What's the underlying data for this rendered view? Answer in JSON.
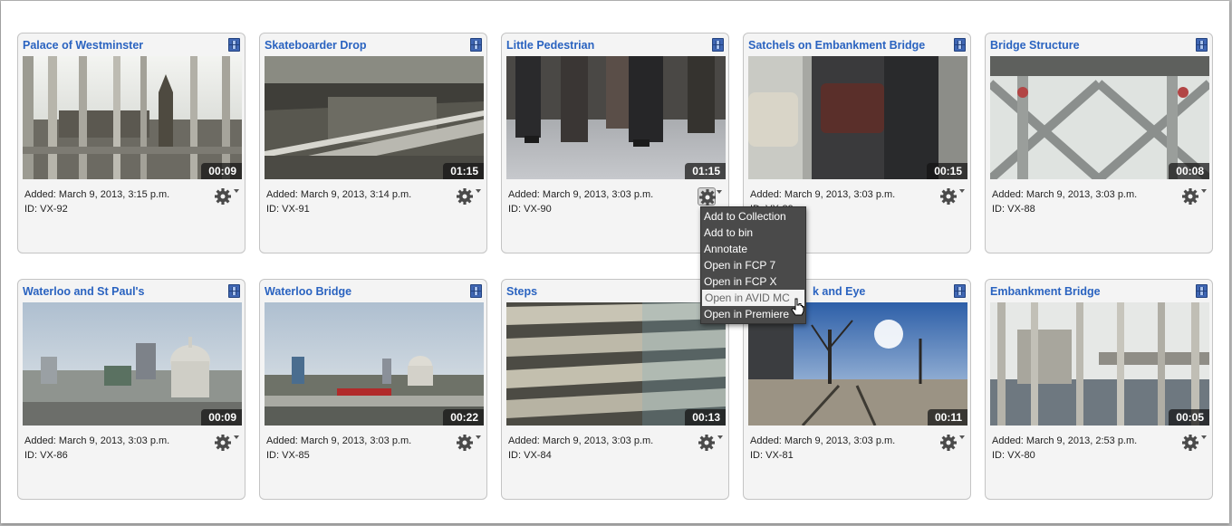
{
  "cards": [
    {
      "title": "Palace of Westminster",
      "duration": "00:09",
      "added": "Added: March 9, 2013, 3:15 p.m.",
      "id": "ID: VX-92"
    },
    {
      "title": "Skateboarder Drop",
      "duration": "01:15",
      "added": "Added: March 9, 2013, 3:14 p.m.",
      "id": "ID: VX-91"
    },
    {
      "title": "Little Pedestrian",
      "duration": "01:15",
      "added": "Added: March 9, 2013, 3:03 p.m.",
      "id": "ID: VX-90"
    },
    {
      "title": "Satchels on Embankment Bridge",
      "duration": "00:15",
      "added": "Added: March 9, 2013, 3:03 p.m.",
      "id": "ID: VX-89"
    },
    {
      "title": "Bridge Structure",
      "duration": "00:08",
      "added": "Added: March 9, 2013, 3:03 p.m.",
      "id": "ID: VX-88"
    },
    {
      "title": "Waterloo and St Paul's",
      "duration": "00:09",
      "added": "Added: March 9, 2013, 3:03 p.m.",
      "id": "ID: VX-86"
    },
    {
      "title": "Waterloo Bridge",
      "duration": "00:22",
      "added": "Added: March 9, 2013, 3:03 p.m.",
      "id": "ID: VX-85"
    },
    {
      "title": "Steps",
      "duration": "00:13",
      "added": "Added: March 9, 2013, 3:03 p.m.",
      "id": "ID: VX-84"
    },
    {
      "title": "k and Eye",
      "duration": "00:11",
      "added": "Added: March 9, 2013, 3:03 p.m.",
      "id": "ID: VX-81"
    },
    {
      "title": "Embankment Bridge",
      "duration": "00:05",
      "added": "Added: March 9, 2013, 2:53 p.m.",
      "id": "ID: VX-80"
    }
  ],
  "context_menu": {
    "items": [
      "Add to Collection",
      "Add to bin",
      "Annotate",
      "Open in FCP 7",
      "Open in FCP X",
      "Open in AVID MC",
      "Open in Premiere"
    ],
    "hovered": "Open in AVID MC"
  },
  "icons": {
    "clip": "film-icon",
    "actions": "gear-icon",
    "pointer": "hand-cursor-icon"
  },
  "colors": {
    "title_link": "#2a63c0",
    "menu_bg": "#4a4a4a",
    "card_bg": "#f4f4f4"
  }
}
